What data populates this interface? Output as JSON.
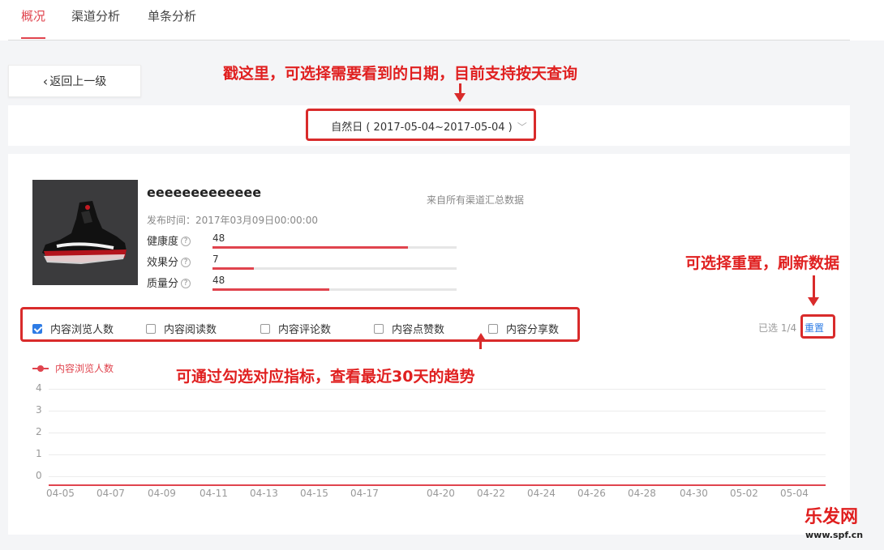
{
  "tabs": [
    {
      "label": "概况",
      "active": true
    },
    {
      "label": "渠道分析",
      "active": false
    },
    {
      "label": "单条分析",
      "active": false
    }
  ],
  "back_label": "返回上一级",
  "date_select": "自然日 ( 2017-05-04~2017-05-04 )",
  "article": {
    "title": "eeeeeeeeeeeee",
    "source": "来自所有渠道汇总数据",
    "pubtime": "发布时间：2017年03月09日00:00:00",
    "thumbnail_icon": "sneaker-image"
  },
  "metrics": [
    {
      "label": "健康度",
      "value": "48",
      "fill": 0.8
    },
    {
      "label": "效果分",
      "value": "7",
      "fill": 0.17
    },
    {
      "label": "质量分",
      "value": "48",
      "fill": 0.48
    }
  ],
  "checkboxes": [
    {
      "label": "内容浏览人数",
      "checked": true
    },
    {
      "label": "内容阅读数",
      "checked": false
    },
    {
      "label": "内容评论数",
      "checked": false
    },
    {
      "label": "内容点赞数",
      "checked": false
    },
    {
      "label": "内容分享数",
      "checked": false
    }
  ],
  "selected_count": "已选 1/4",
  "reset_label": "重置",
  "chart_data": {
    "type": "line",
    "series": [
      {
        "name": "内容浏览人数",
        "values": [
          0
        ]
      }
    ],
    "y_ticks": [
      "4",
      "3",
      "2",
      "1",
      "0"
    ],
    "x_ticks": [
      "04-05",
      "04-07",
      "04-09",
      "04-11",
      "04-13",
      "04-15",
      "04-17",
      "04-20",
      "04-22",
      "04-24",
      "04-26",
      "04-28",
      "04-30",
      "05-02",
      "05-04"
    ],
    "ylim": [
      0,
      4
    ],
    "color": "#e0444e"
  },
  "annotations": {
    "date_hint": "戳这里，可选择需要看到的日期，目前支持按天查询",
    "reset_hint": "可选择重置，刷新数据",
    "check_hint": "可通过勾选对应指标，查看最近30天的趋势"
  },
  "watermark": {
    "text": "乐发网",
    "url": "www.spf.cn"
  }
}
